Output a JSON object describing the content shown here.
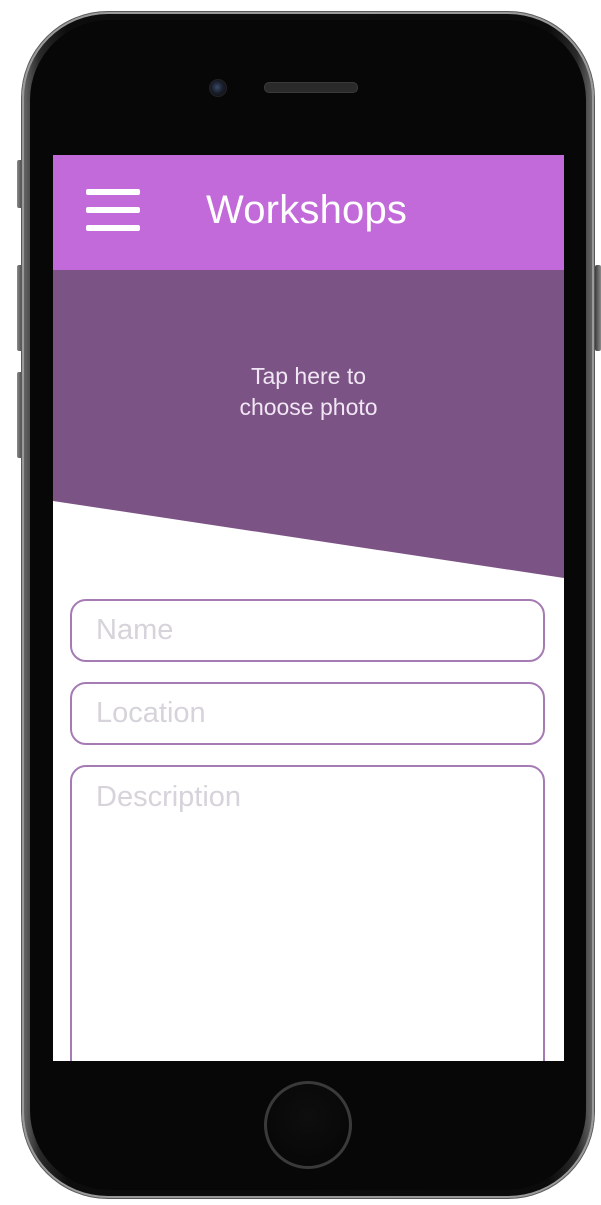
{
  "header": {
    "title": "Workshops",
    "menu_icon": "hamburger-menu-icon",
    "background_color": "#c26ad9"
  },
  "photo_picker": {
    "line1": "Tap here to",
    "line2": "choose photo",
    "background_color": "#7c5385"
  },
  "form": {
    "name_placeholder": "Name",
    "location_placeholder": "Location",
    "description_placeholder": "Description",
    "border_color": "#a57bb4"
  },
  "device": {
    "home_button_icon": "home-button-icon",
    "camera_icon": "front-camera-icon",
    "speaker_icon": "earpiece-speaker-icon"
  }
}
